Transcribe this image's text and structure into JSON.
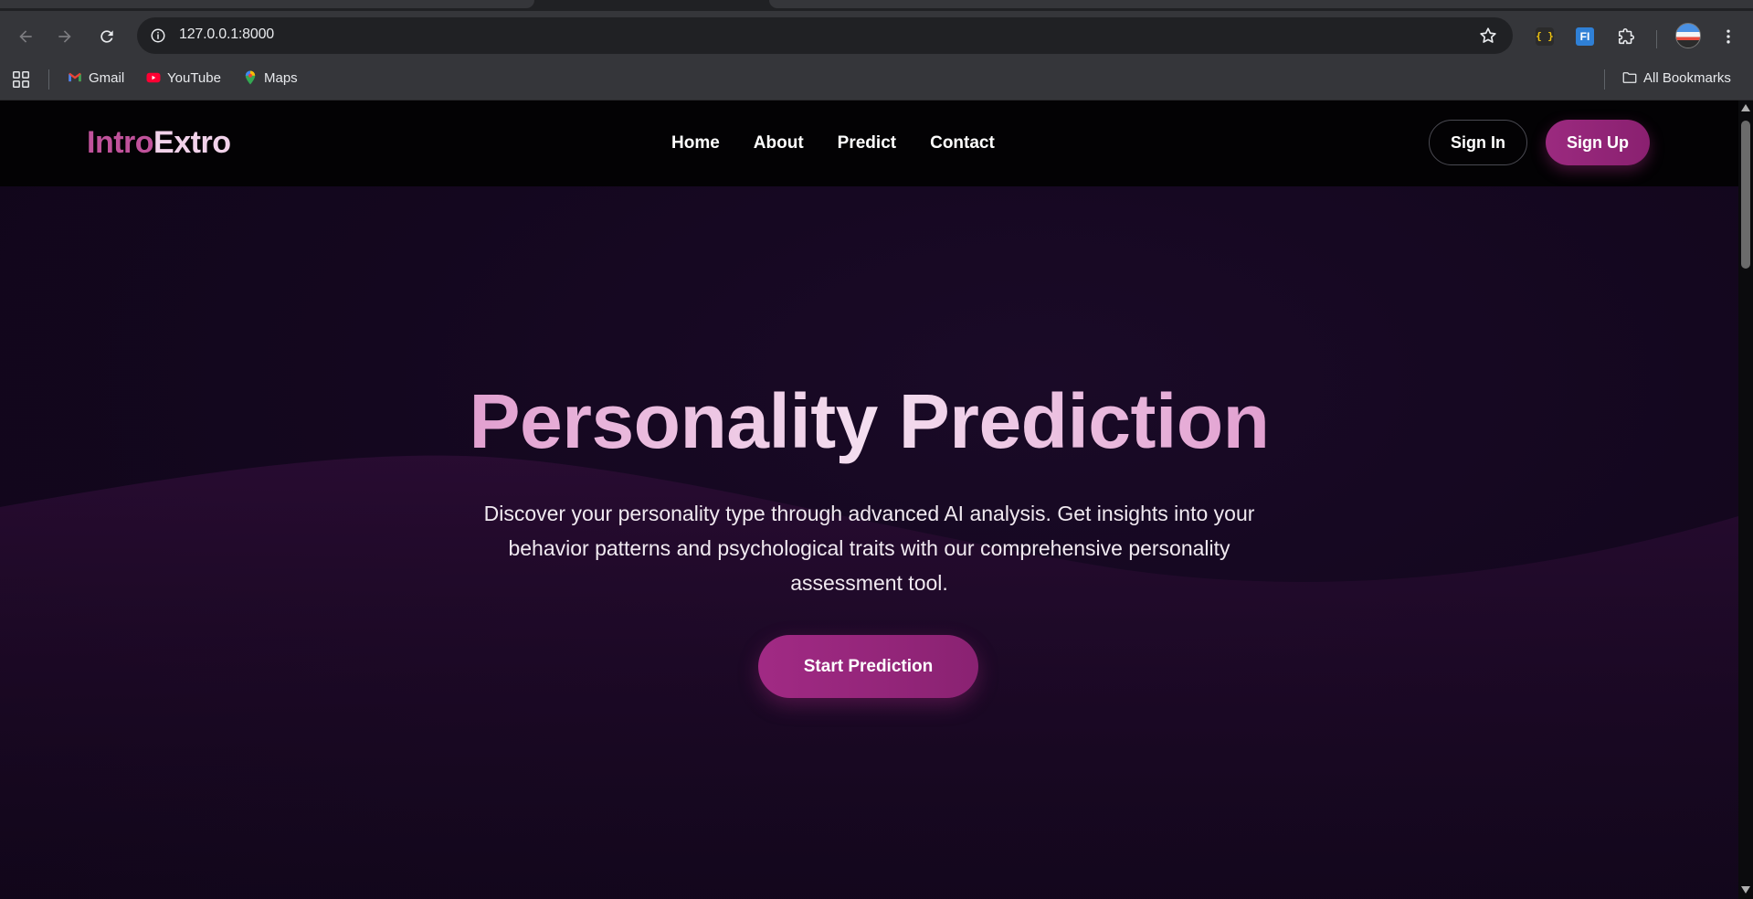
{
  "browser": {
    "url": "127.0.0.1:8000",
    "bookmarks": [
      {
        "label": "Gmail"
      },
      {
        "label": "YouTube"
      },
      {
        "label": "Maps"
      }
    ],
    "all_bookmarks_label": "All Bookmarks"
  },
  "site": {
    "logo": {
      "part1": "Intro",
      "part2": "Extro"
    },
    "nav_links": [
      "Home",
      "About",
      "Predict",
      "Contact"
    ],
    "sign_in_label": "Sign In",
    "sign_up_label": "Sign Up"
  },
  "hero": {
    "title": "Personality Prediction",
    "subtitle": "Discover your personality type through advanced AI analysis. Get insights into your behavior patterns and psychological traits with our comprehensive personality assessment tool.",
    "cta_label": "Start Prediction"
  },
  "colors": {
    "accent": "#9b2a7f",
    "logo_primary": "#c0529b",
    "logo_secondary": "#f1d2ea",
    "page_background": "#14071f"
  }
}
